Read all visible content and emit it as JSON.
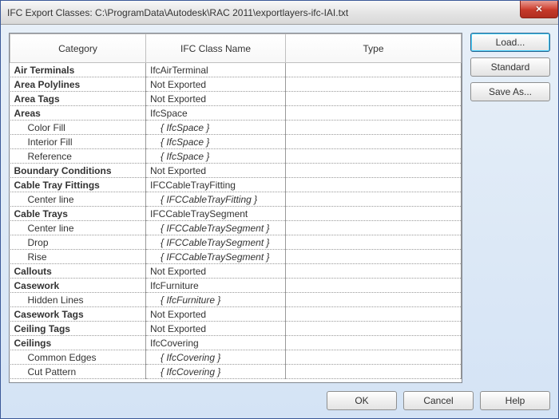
{
  "window": {
    "title": "IFC Export Classes:  C:\\ProgramData\\Autodesk\\RAC 2011\\exportlayers-ifc-IAI.txt"
  },
  "columns": {
    "category": "Category",
    "ifcclass": "IFC Class Name",
    "type": "Type"
  },
  "rows": [
    {
      "cat": "Air Terminals",
      "ifc": "IfcAirTerminal",
      "main": true
    },
    {
      "cat": "Area Polylines",
      "ifc": "Not Exported",
      "main": true
    },
    {
      "cat": "Area Tags",
      "ifc": "Not Exported",
      "main": true
    },
    {
      "cat": "Areas",
      "ifc": "IfcSpace",
      "main": true
    },
    {
      "cat": "Color Fill",
      "ifc": "{ IfcSpace }",
      "main": false
    },
    {
      "cat": "Interior Fill",
      "ifc": "{ IfcSpace }",
      "main": false
    },
    {
      "cat": "Reference",
      "ifc": "{ IfcSpace }",
      "main": false
    },
    {
      "cat": "Boundary Conditions",
      "ifc": "Not Exported",
      "main": true
    },
    {
      "cat": "Cable Tray Fittings",
      "ifc": "IFCCableTrayFitting",
      "main": true
    },
    {
      "cat": "Center line",
      "ifc": "{ IFCCableTrayFitting }",
      "main": false
    },
    {
      "cat": "Cable Trays",
      "ifc": "IFCCableTraySegment",
      "main": true
    },
    {
      "cat": "Center line",
      "ifc": "{ IFCCableTraySegment }",
      "main": false
    },
    {
      "cat": "Drop",
      "ifc": "{ IFCCableTraySegment }",
      "main": false
    },
    {
      "cat": "Rise",
      "ifc": "{ IFCCableTraySegment }",
      "main": false
    },
    {
      "cat": "Callouts",
      "ifc": "Not Exported",
      "main": true
    },
    {
      "cat": "Casework",
      "ifc": "IfcFurniture",
      "main": true
    },
    {
      "cat": "Hidden Lines",
      "ifc": "{ IfcFurniture }",
      "main": false
    },
    {
      "cat": "Casework Tags",
      "ifc": "Not Exported",
      "main": true
    },
    {
      "cat": "Ceiling Tags",
      "ifc": "Not Exported",
      "main": true
    },
    {
      "cat": "Ceilings",
      "ifc": "IfcCovering",
      "main": true
    },
    {
      "cat": "Common Edges",
      "ifc": "{ IfcCovering }",
      "main": false
    },
    {
      "cat": "Cut Pattern",
      "ifc": "{ IfcCovering }",
      "main": false
    }
  ],
  "sideButtons": {
    "load": "Load...",
    "standard": "Standard",
    "saveas": "Save As..."
  },
  "bottomButtons": {
    "ok": "OK",
    "cancel": "Cancel",
    "help": "Help"
  }
}
